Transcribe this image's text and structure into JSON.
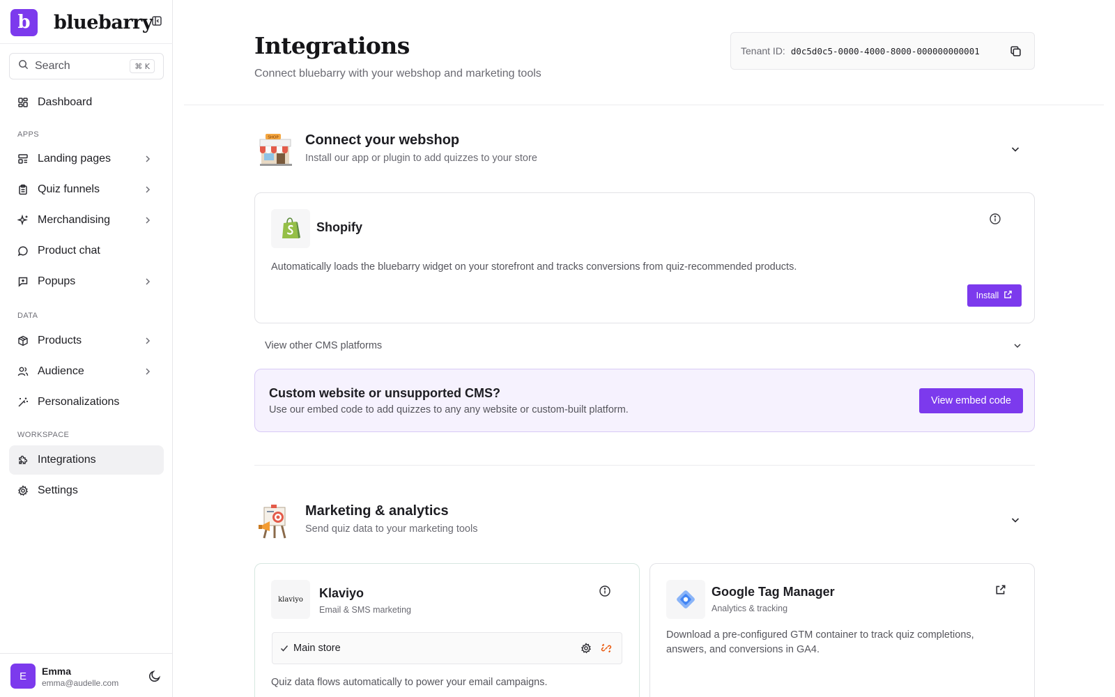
{
  "sidebar": {
    "brand": {
      "logo_letter": "b",
      "name": "bluebarry"
    },
    "search": {
      "label": "Search",
      "shortcut": "⌘ K"
    },
    "dashboard": {
      "label": "Dashboard"
    },
    "sections": {
      "apps": "APPS",
      "data": "DATA",
      "workspace": "WORKSPACE"
    },
    "items": {
      "landing_pages": "Landing pages",
      "quiz_funnels": "Quiz funnels",
      "merchandising": "Merchandising",
      "product_chat": "Product chat",
      "popups": "Popups",
      "products": "Products",
      "audience": "Audience",
      "personalizations": "Personalizations",
      "integrations": "Integrations",
      "settings": "Settings"
    },
    "active_item": "integrations",
    "user": {
      "initial": "E",
      "name": "Emma",
      "email": "emma@audelle.com"
    }
  },
  "header": {
    "title": "Integrations",
    "subtitle": "Connect bluebarry with your webshop and marketing tools",
    "tenant_label": "Tenant ID:",
    "tenant_id": "d0c5d0c5-0000-4000-8000-000000000001"
  },
  "webshop": {
    "title": "Connect your webshop",
    "subtitle": "Install our app or plugin to add quizzes to your store",
    "shopify": {
      "name": "Shopify",
      "description": "Automatically loads the bluebarry widget on your storefront and tracks conversions from quiz-recommended products.",
      "install_label": "Install"
    },
    "other_cms_label": "View other CMS platforms",
    "custom": {
      "title": "Custom website or unsupported CMS?",
      "subtitle": "Use our embed code to add quizzes to any any website or custom-built platform.",
      "button_label": "View embed code"
    }
  },
  "marketing": {
    "title": "Marketing & analytics",
    "subtitle": "Send quiz data to your marketing tools",
    "klaviyo": {
      "logo_text": "klaviyo",
      "name": "Klaviyo",
      "category": "Email & SMS marketing",
      "store_name": "Main store",
      "description": "Quiz data flows automatically to power your email campaigns."
    },
    "gtm": {
      "name": "Google Tag Manager",
      "category": "Analytics & tracking",
      "description": "Download a pre-configured GTM container to track quiz completions, answers, and conversions in GA4."
    }
  },
  "colors": {
    "accent": "#7c3aed",
    "accent_soft": "#f6f2fe",
    "shopify_green": "#95bf47",
    "gtm_blue": "#4285f4",
    "unlink_orange": "#ea580c"
  }
}
